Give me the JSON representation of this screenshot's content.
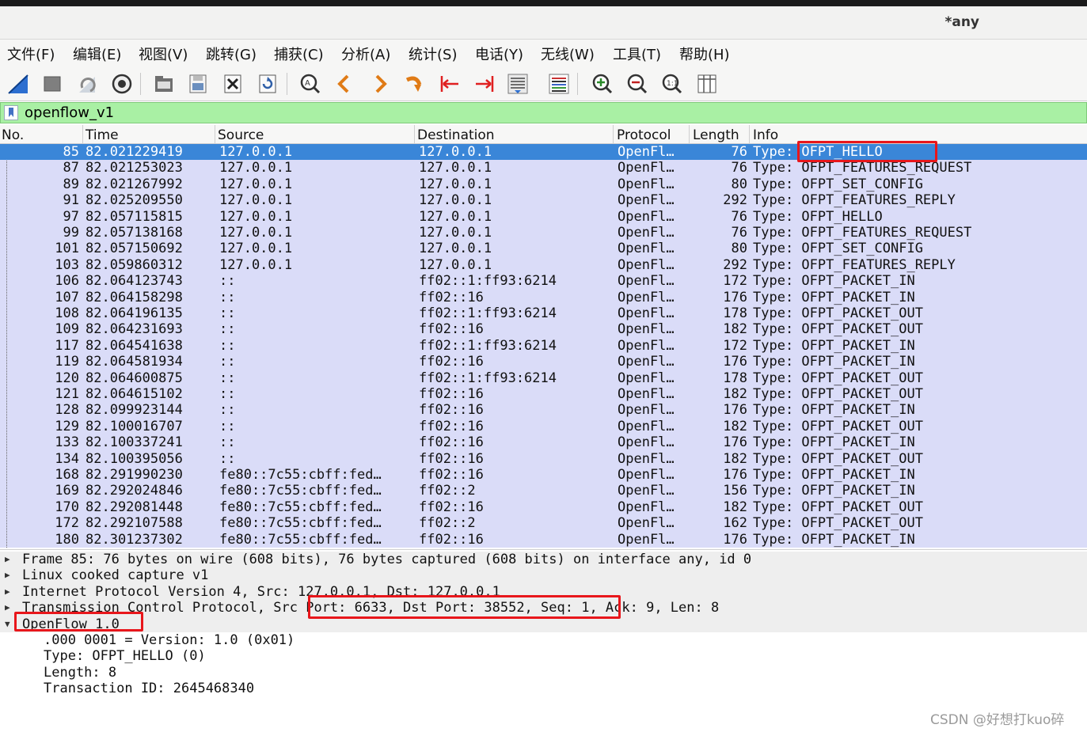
{
  "window": {
    "title": "*any"
  },
  "menu": [
    "文件(F)",
    "编辑(E)",
    "视图(V)",
    "跳转(G)",
    "捕获(C)",
    "分析(A)",
    "统计(S)",
    "电话(Y)",
    "无线(W)",
    "工具(T)",
    "帮助(H)"
  ],
  "toolbar_icons": [
    "start-capture-icon",
    "stop-capture-icon",
    "restart-capture-icon",
    "capture-options-icon",
    "open-file-icon",
    "save-file-icon",
    "close-file-icon",
    "reload-icon",
    "find-packet-icon",
    "go-back-icon",
    "go-forward-icon",
    "go-to-packet-icon",
    "first-packet-icon",
    "last-packet-icon",
    "autoscroll-icon",
    "colorize-icon",
    "zoom-in-icon",
    "zoom-out-icon",
    "normal-size-icon",
    "resize-columns-icon"
  ],
  "filter": {
    "value": "openflow_v1"
  },
  "columns": [
    "No.",
    "Time",
    "Source",
    "Destination",
    "Protocol",
    "Length",
    "Info"
  ],
  "packets": [
    {
      "no": "85",
      "time": "82.021229419",
      "src": "127.0.0.1",
      "dst": "127.0.0.1",
      "proto": "OpenFl…",
      "len": "76",
      "info": "Type: OFPT_HELLO"
    },
    {
      "no": "87",
      "time": "82.021253023",
      "src": "127.0.0.1",
      "dst": "127.0.0.1",
      "proto": "OpenFl…",
      "len": "76",
      "info": "Type: OFPT_FEATURES_REQUEST"
    },
    {
      "no": "89",
      "time": "82.021267992",
      "src": "127.0.0.1",
      "dst": "127.0.0.1",
      "proto": "OpenFl…",
      "len": "80",
      "info": "Type: OFPT_SET_CONFIG"
    },
    {
      "no": "91",
      "time": "82.025209550",
      "src": "127.0.0.1",
      "dst": "127.0.0.1",
      "proto": "OpenFl…",
      "len": "292",
      "info": "Type: OFPT_FEATURES_REPLY"
    },
    {
      "no": "97",
      "time": "82.057115815",
      "src": "127.0.0.1",
      "dst": "127.0.0.1",
      "proto": "OpenFl…",
      "len": "76",
      "info": "Type: OFPT_HELLO"
    },
    {
      "no": "99",
      "time": "82.057138168",
      "src": "127.0.0.1",
      "dst": "127.0.0.1",
      "proto": "OpenFl…",
      "len": "76",
      "info": "Type: OFPT_FEATURES_REQUEST"
    },
    {
      "no": "101",
      "time": "82.057150692",
      "src": "127.0.0.1",
      "dst": "127.0.0.1",
      "proto": "OpenFl…",
      "len": "80",
      "info": "Type: OFPT_SET_CONFIG"
    },
    {
      "no": "103",
      "time": "82.059860312",
      "src": "127.0.0.1",
      "dst": "127.0.0.1",
      "proto": "OpenFl…",
      "len": "292",
      "info": "Type: OFPT_FEATURES_REPLY"
    },
    {
      "no": "106",
      "time": "82.064123743",
      "src": "::",
      "dst": "ff02::1:ff93:6214",
      "proto": "OpenFl…",
      "len": "172",
      "info": "Type: OFPT_PACKET_IN"
    },
    {
      "no": "107",
      "time": "82.064158298",
      "src": "::",
      "dst": "ff02::16",
      "proto": "OpenFl…",
      "len": "176",
      "info": "Type: OFPT_PACKET_IN"
    },
    {
      "no": "108",
      "time": "82.064196135",
      "src": "::",
      "dst": "ff02::1:ff93:6214",
      "proto": "OpenFl…",
      "len": "178",
      "info": "Type: OFPT_PACKET_OUT"
    },
    {
      "no": "109",
      "time": "82.064231693",
      "src": "::",
      "dst": "ff02::16",
      "proto": "OpenFl…",
      "len": "182",
      "info": "Type: OFPT_PACKET_OUT"
    },
    {
      "no": "117",
      "time": "82.064541638",
      "src": "::",
      "dst": "ff02::1:ff93:6214",
      "proto": "OpenFl…",
      "len": "172",
      "info": "Type: OFPT_PACKET_IN"
    },
    {
      "no": "119",
      "time": "82.064581934",
      "src": "::",
      "dst": "ff02::16",
      "proto": "OpenFl…",
      "len": "176",
      "info": "Type: OFPT_PACKET_IN"
    },
    {
      "no": "120",
      "time": "82.064600875",
      "src": "::",
      "dst": "ff02::1:ff93:6214",
      "proto": "OpenFl…",
      "len": "178",
      "info": "Type: OFPT_PACKET_OUT"
    },
    {
      "no": "121",
      "time": "82.064615102",
      "src": "::",
      "dst": "ff02::16",
      "proto": "OpenFl…",
      "len": "182",
      "info": "Type: OFPT_PACKET_OUT"
    },
    {
      "no": "128",
      "time": "82.099923144",
      "src": "::",
      "dst": "ff02::16",
      "proto": "OpenFl…",
      "len": "176",
      "info": "Type: OFPT_PACKET_IN"
    },
    {
      "no": "129",
      "time": "82.100016707",
      "src": "::",
      "dst": "ff02::16",
      "proto": "OpenFl…",
      "len": "182",
      "info": "Type: OFPT_PACKET_OUT"
    },
    {
      "no": "133",
      "time": "82.100337241",
      "src": "::",
      "dst": "ff02::16",
      "proto": "OpenFl…",
      "len": "176",
      "info": "Type: OFPT_PACKET_IN"
    },
    {
      "no": "134",
      "time": "82.100395056",
      "src": "::",
      "dst": "ff02::16",
      "proto": "OpenFl…",
      "len": "182",
      "info": "Type: OFPT_PACKET_OUT"
    },
    {
      "no": "168",
      "time": "82.291990230",
      "src": "fe80::7c55:cbff:fed…",
      "dst": "ff02::16",
      "proto": "OpenFl…",
      "len": "176",
      "info": "Type: OFPT_PACKET_IN"
    },
    {
      "no": "169",
      "time": "82.292024846",
      "src": "fe80::7c55:cbff:fed…",
      "dst": "ff02::2",
      "proto": "OpenFl…",
      "len": "156",
      "info": "Type: OFPT_PACKET_IN"
    },
    {
      "no": "170",
      "time": "82.292081448",
      "src": "fe80::7c55:cbff:fed…",
      "dst": "ff02::16",
      "proto": "OpenFl…",
      "len": "182",
      "info": "Type: OFPT_PACKET_OUT"
    },
    {
      "no": "172",
      "time": "82.292107588",
      "src": "fe80::7c55:cbff:fed…",
      "dst": "ff02::2",
      "proto": "OpenFl…",
      "len": "162",
      "info": "Type: OFPT_PACKET_OUT"
    },
    {
      "no": "180",
      "time": "82.301237302",
      "src": "fe80::7c55:cbff:fed…",
      "dst": "ff02::16",
      "proto": "OpenFl…",
      "len": "176",
      "info": "Type: OFPT_PACKET_IN"
    }
  ],
  "details": [
    {
      "text": "Frame 85: 76 bytes on wire (608 bits), 76 bytes captured (608 bits) on interface any, id 0",
      "arrow": "▶",
      "shaded": true
    },
    {
      "text": "Linux cooked capture v1",
      "arrow": "▶",
      "shaded": true
    },
    {
      "text": "Internet Protocol Version 4, Src: 127.0.0.1, Dst: 127.0.0.1",
      "arrow": "▶",
      "shaded": true
    },
    {
      "text": "Transmission Control Protocol, Src Port: 6633, Dst Port: 38552, Seq: 1, Ack: 9, Len: 8",
      "arrow": "▶",
      "shaded": true
    },
    {
      "text": "OpenFlow 1.0",
      "arrow": "▼",
      "shaded": true
    },
    {
      "text": ".000 0001 = Version: 1.0 (0x01)",
      "arrow": "",
      "shaded": false
    },
    {
      "text": "Type: OFPT_HELLO (0)",
      "arrow": "",
      "shaded": false
    },
    {
      "text": "Length: 8",
      "arrow": "",
      "shaded": false
    },
    {
      "text": "Transaction ID: 2645468340",
      "arrow": "",
      "shaded": false
    }
  ],
  "watermark": "CSDN @好想打kuo碎",
  "colors": {
    "selected_row": "#3a86d8",
    "row_bg": "#dadcf8",
    "filter_bg": "#a9f0a4",
    "highlight_box": "#e8161b"
  }
}
